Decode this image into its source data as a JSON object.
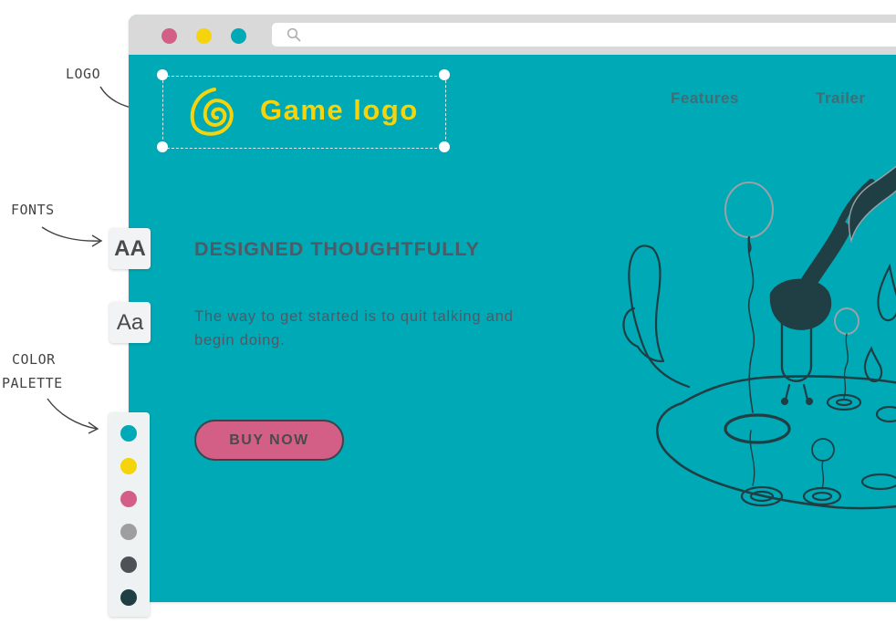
{
  "annotations": {
    "logo": "LOGO",
    "fonts": "FONTS",
    "color_palette_1": "COLOR",
    "color_palette_2": "PALETTE"
  },
  "browser": {
    "window_buttons": [
      "#d35f87",
      "#f6d40c",
      "#00a9b6"
    ],
    "address_icon": "search-icon"
  },
  "page": {
    "logo_text": "Game logo",
    "logo_icon": "spiral-icon",
    "nav": [
      "Features",
      "Trailer"
    ],
    "headline": "DESIGNED THOUGHTFULLY",
    "body": "The way to get started is to quit talking and begin doing.",
    "cta": "BUY NOW"
  },
  "fonts_panel": [
    "AA",
    "Aa"
  ],
  "palette": [
    "#00a9b6",
    "#f6d40c",
    "#d35f87",
    "#9e9e9e",
    "#4e5257",
    "#1f3f44"
  ],
  "colors": {
    "background": "#00a9b6",
    "accent_yellow": "#f6d40c",
    "accent_pink": "#d35f87",
    "text_dark": "#4e5a66"
  }
}
